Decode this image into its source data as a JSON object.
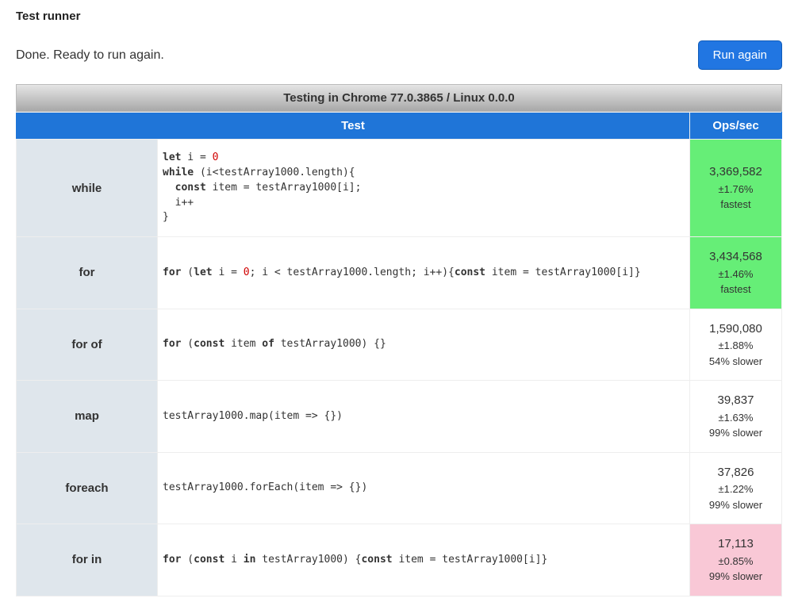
{
  "title": "Test runner",
  "status": "Done. Ready to run again.",
  "run_button": "Run again",
  "caption": "Testing in Chrome 77.0.3865 / Linux 0.0.0",
  "headers": {
    "test": "Test",
    "ops": "Ops/sec"
  },
  "rows": [
    {
      "name": "while",
      "code_html": "<span class='kw'>let</span> i = <span class='num'>0</span>\n<span class='kw'>while</span> (i&lt;testArray1000.length){\n  <span class='kw'>const</span> item = testArray1000[i];\n  i++\n}",
      "ops": "3,369,582",
      "err": "±1.76%",
      "note": "fastest",
      "class": "fastest"
    },
    {
      "name": "for",
      "code_html": "<span class='kw'>for</span> (<span class='kw'>let</span> i = <span class='num'>0</span>; i &lt; testArray1000.length; i++){<span class='kw'>const</span> item = testArray1000[i]}",
      "ops": "3,434,568",
      "err": "±1.46%",
      "note": "fastest",
      "class": "fastest"
    },
    {
      "name": "for of",
      "code_html": "<span class='kw'>for</span> (<span class='kw'>const</span> item <span class='kw'>of</span> testArray1000) {}",
      "ops": "1,590,080",
      "err": "±1.88%",
      "note": "54% slower",
      "class": ""
    },
    {
      "name": "map",
      "code_html": "testArray1000.map(item =&gt; {})",
      "ops": "39,837",
      "err": "±1.63%",
      "note": "99% slower",
      "class": ""
    },
    {
      "name": "foreach",
      "code_html": "testArray1000.forEach(item =&gt; {})",
      "ops": "37,826",
      "err": "±1.22%",
      "note": "99% slower",
      "class": ""
    },
    {
      "name": "for in",
      "code_html": "<span class='kw'>for</span> (<span class='kw'>const</span> i <span class='kw'>in</span> testArray1000) {<span class='kw'>const</span> item = testArray1000[i]}",
      "ops": "17,113",
      "err": "±0.85%",
      "note": "99% slower",
      "class": "slowest"
    }
  ]
}
